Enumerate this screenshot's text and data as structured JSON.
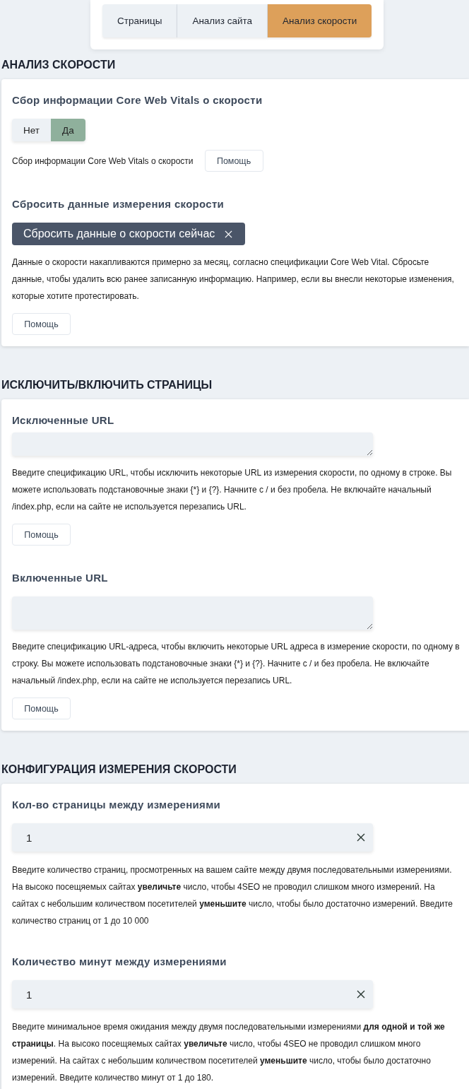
{
  "tabs": [
    {
      "label": "Страницы",
      "selected": false
    },
    {
      "label": "Анализ сайта",
      "selected": false
    },
    {
      "label": "Анализ скорости",
      "selected": true
    }
  ],
  "sections": [
    {
      "heading": "АНАЛИЗ СКОРОСТИ",
      "fields": [
        {
          "kind": "toggle",
          "title": "Сбор информации Core Web Vitals о скорости",
          "options": [
            {
              "label": "Нет",
              "selected": false
            },
            {
              "label": "Да",
              "selected": true
            }
          ],
          "description": "Сбор информации Core Web Vitals о скорости",
          "help": "Помощь"
        },
        {
          "kind": "action",
          "title": "Сбросить данные измерения скорости",
          "button": "Сбросить данные о скорости сейчас",
          "description": "Данные о скорости накапливаются примерно за месяц, согласно спецификации Core Web Vital. Сбросьте данные, чтобы удалить всю ранее записанную информацию. Например, если вы внесли некоторые изменения, которые хотите протестировать.",
          "help": "Помощь"
        }
      ]
    },
    {
      "heading": "ИСКЛЮЧИТЬ/ВКЛЮЧИТЬ СТРАНИЦЫ",
      "fields": [
        {
          "kind": "textarea",
          "title": "Исключенные URL",
          "description": "Введите спецификацию URL, чтобы исключить некоторые URL из измерения скорости, по одному в строке. Вы можете использовать подстановочные знаки {*} и {?}. Начните с / и без пробела. Не включайте начальный /index.php, если на сайте не используется перезапись URL.",
          "help": "Помощь"
        },
        {
          "kind": "textarea",
          "title": "Включенные URL",
          "description": "Введите спецификацию URL-адреса, чтобы включить некоторые URL адреса в измерение скорости, по одному в строку. Вы можете использовать подстановочные знаки {*} и {?}. Начните с / и без пробела. Не включайте начальный /index.php, если на сайте не используется перезапись URL.",
          "help": "Помощь"
        }
      ]
    },
    {
      "heading": "КОНФИГУРАЦИЯ ИЗМЕРЕНИЯ СКОРОСТИ",
      "fields": [
        {
          "kind": "number",
          "title": "Кол-во страницы между измерениями",
          "value": "1",
          "description": "Введите количество страниц, просмотренных на вашем сайте между двумя последовательными измерениями. На высоко посещяемых сайтах **увеличьте** число, чтобы 4SEO не проводил слишком много измерений. На сайтах с небольшим количеством посетителей **уменьшите** число, чтобы было достаточно измерений. Введите количество страниц от 1 до 10 000"
        },
        {
          "kind": "number",
          "title": "Количество минут между измерениями",
          "value": "1",
          "description": "Введите минимальное время ожидания между двумя последовательными измерениями **для одной и той же страницы**. На высоко посещяемых сайтах **увеличьте** число, чтобы 4SEO не проводил слишком много измерений. На сайтах с небольшим количеством посетителей **уменьшите** число, чтобы было достаточно измерений. Введите количество минут от 1 до 180."
        }
      ]
    }
  ]
}
